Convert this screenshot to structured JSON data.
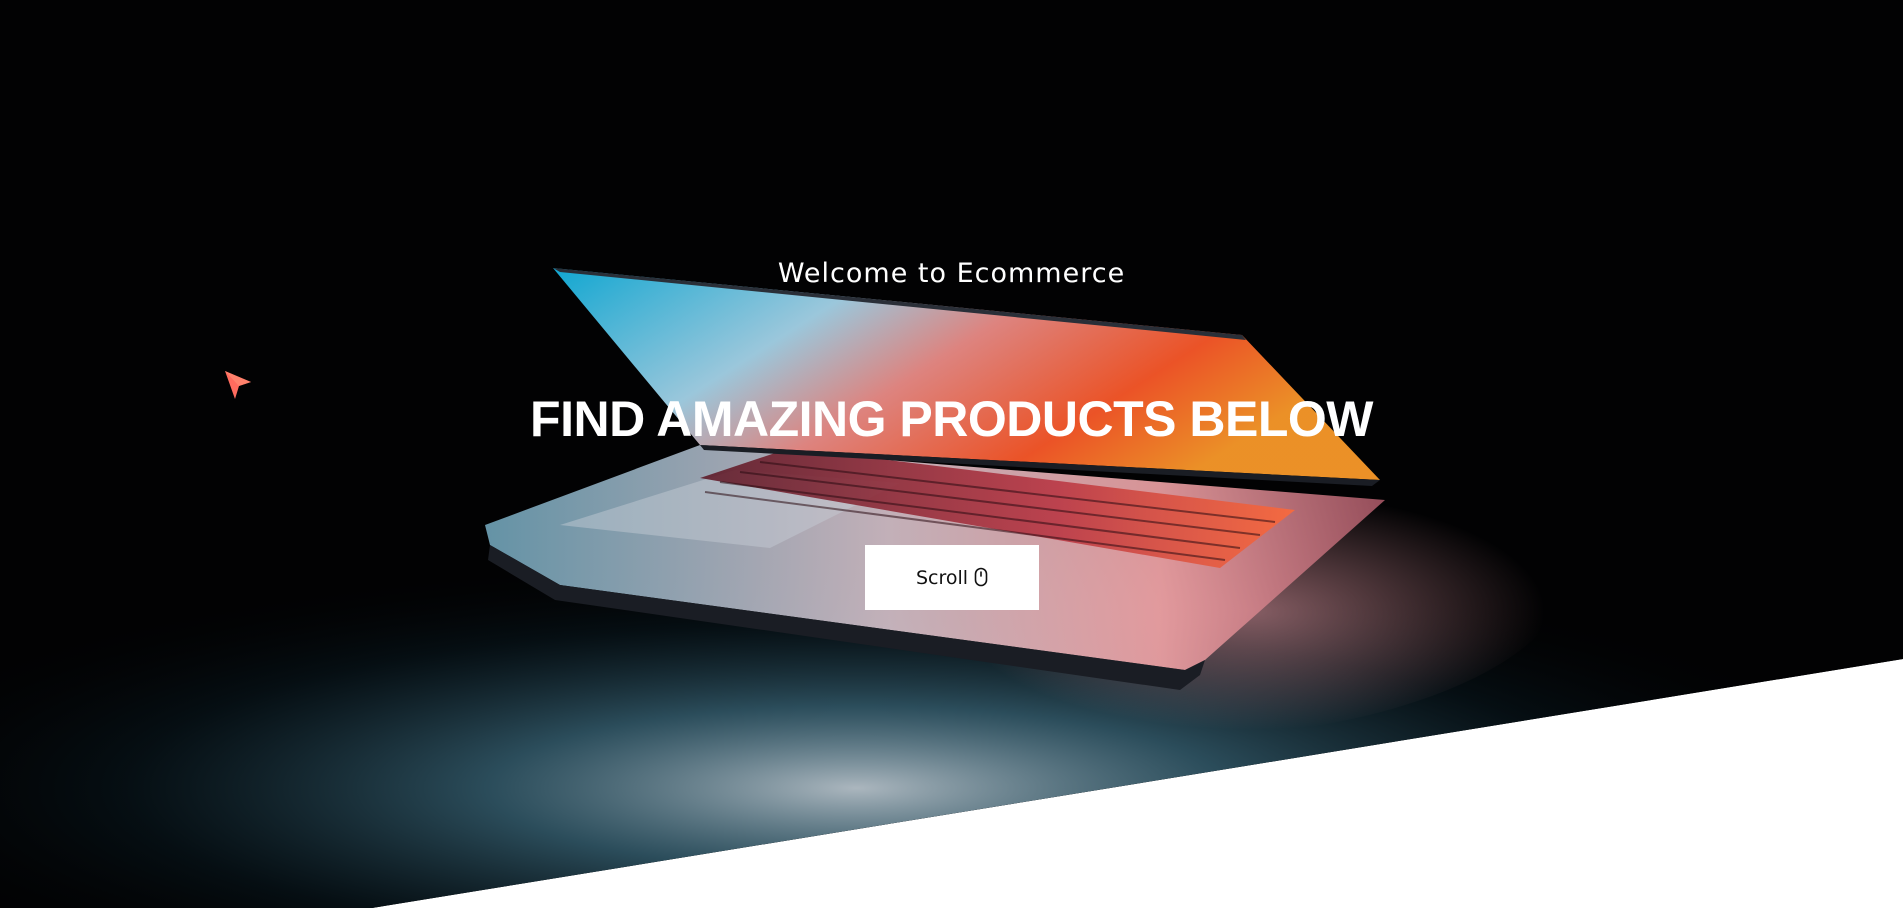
{
  "hero": {
    "welcome_text": "Welcome to Ecommerce",
    "headline": "FIND AMAZING PRODUCTS BELOW",
    "scroll_button": {
      "label": "Scroll",
      "icon": "mouse-icon"
    },
    "background_image": "laptop-photo",
    "cursor_icon": "pointer-arrow-icon"
  },
  "colors": {
    "hero_background": "#020203",
    "text": "#ffffff",
    "button_background": "#ffffff",
    "button_text": "#111111",
    "cursor": "#ff6b5e",
    "page_background": "#ffffff"
  }
}
